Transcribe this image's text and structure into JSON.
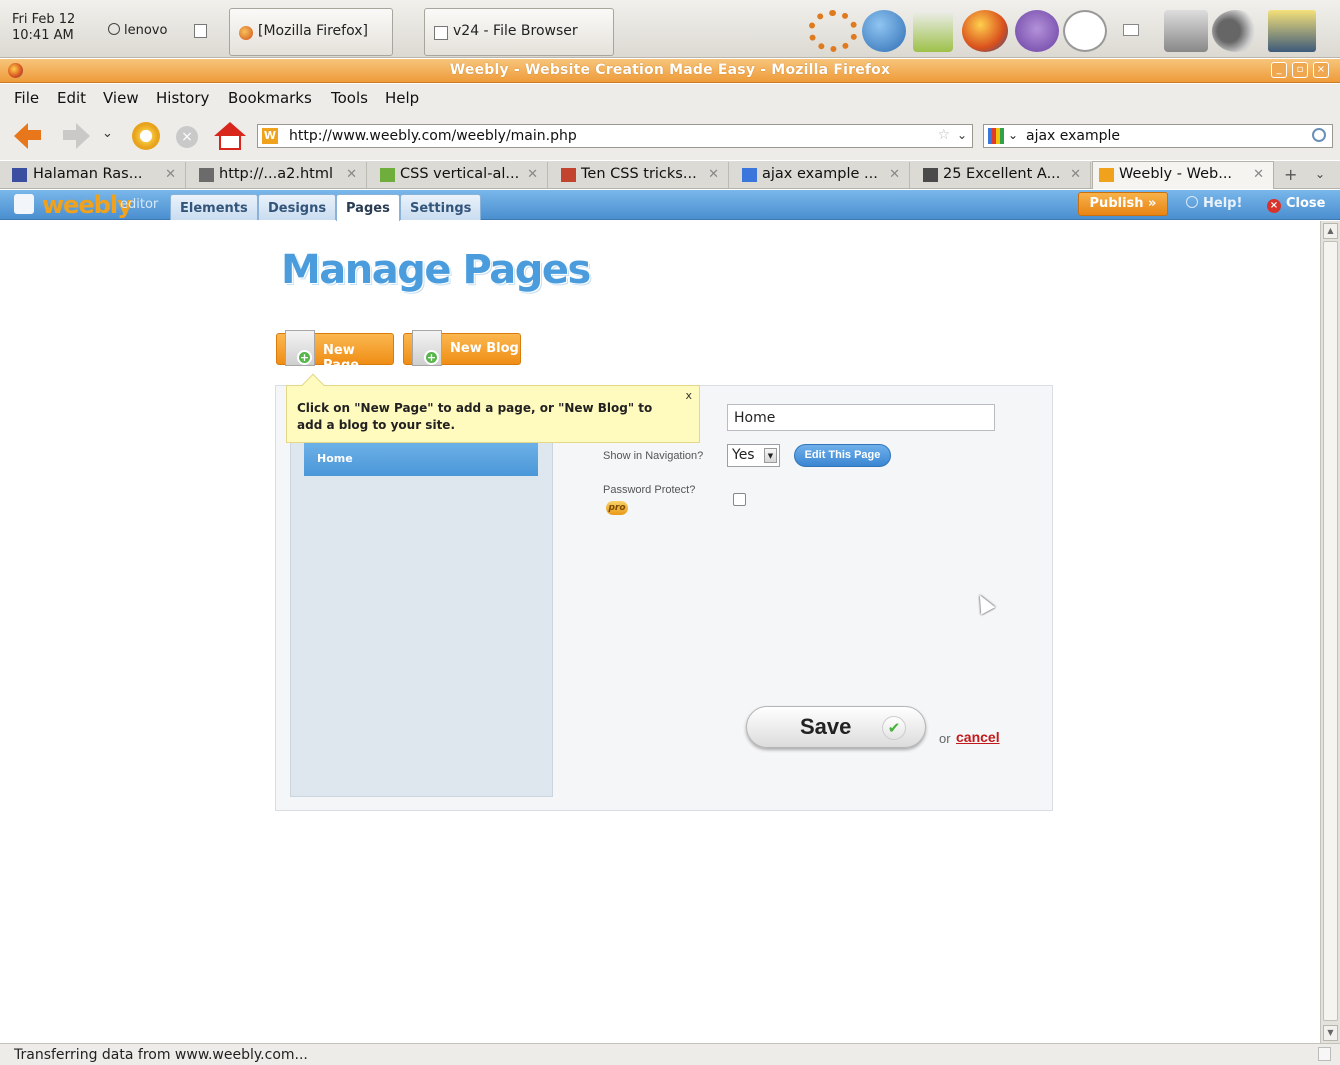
{
  "panel": {
    "clock_line1": "Fri Feb 12",
    "clock_line2": "10:41 AM",
    "user": "lenovo",
    "tasks": [
      "[Mozilla Firefox]",
      "v24 - File Browser"
    ]
  },
  "window": {
    "title": "Weebly - Website Creation Made Easy - Mozilla Firefox"
  },
  "menubar": [
    "File",
    "Edit",
    "View",
    "History",
    "Bookmarks",
    "Tools",
    "Help"
  ],
  "navbar": {
    "url": "http://www.weebly.com/weebly/main.php",
    "url_favicon": "W",
    "search": "ajax example"
  },
  "tabs": [
    {
      "title": "Halaman Ras...",
      "favicon_color": "#3a4fa0"
    },
    {
      "title": "http://...a2.html",
      "favicon_color": "#6b6b6b"
    },
    {
      "title": "CSS vertical-al...",
      "favicon_color": "#6fae3c"
    },
    {
      "title": "Ten CSS tricks...",
      "favicon_color": "#c2432e"
    },
    {
      "title": "ajax example ...",
      "favicon_color": "#3b76dd"
    },
    {
      "title": "25 Excellent A...",
      "favicon_color": "#4a4a4a"
    },
    {
      "title": "Weebly - Web...",
      "favicon_color": "#f0a21d",
      "active": true
    }
  ],
  "editor": {
    "logo": "weebly",
    "logo_suffix": "editor",
    "tabs": [
      "Elements",
      "Designs",
      "Pages",
      "Settings"
    ],
    "active_tab": "Pages",
    "publish": "Publish »",
    "help": "Help!",
    "close": "Close"
  },
  "page": {
    "title": "Manage Pages",
    "new_page": "New Page",
    "new_blog": "New Blog",
    "tooltip": "Click on \"New Page\" to add a page, or \"New Blog\" to add a blog to your site.",
    "tooltip_close": "x",
    "pages": [
      "Home"
    ],
    "page_name_value": "Home",
    "show_nav_label": "Show in Navigation?",
    "show_nav_value": "Yes",
    "edit_page": "Edit This Page",
    "password_label": "Password Protect?",
    "password_checked": false,
    "pro_badge": "pro",
    "save": "Save",
    "or": "or",
    "cancel": "cancel"
  },
  "status": {
    "text": "Transferring data from www.weebly.com..."
  },
  "colors": {
    "weebly_blue": "#4a9cdc",
    "orange_button": "#ef8e16",
    "tooltip_bg": "#fffabe",
    "cancel_red": "#c21a1a"
  }
}
